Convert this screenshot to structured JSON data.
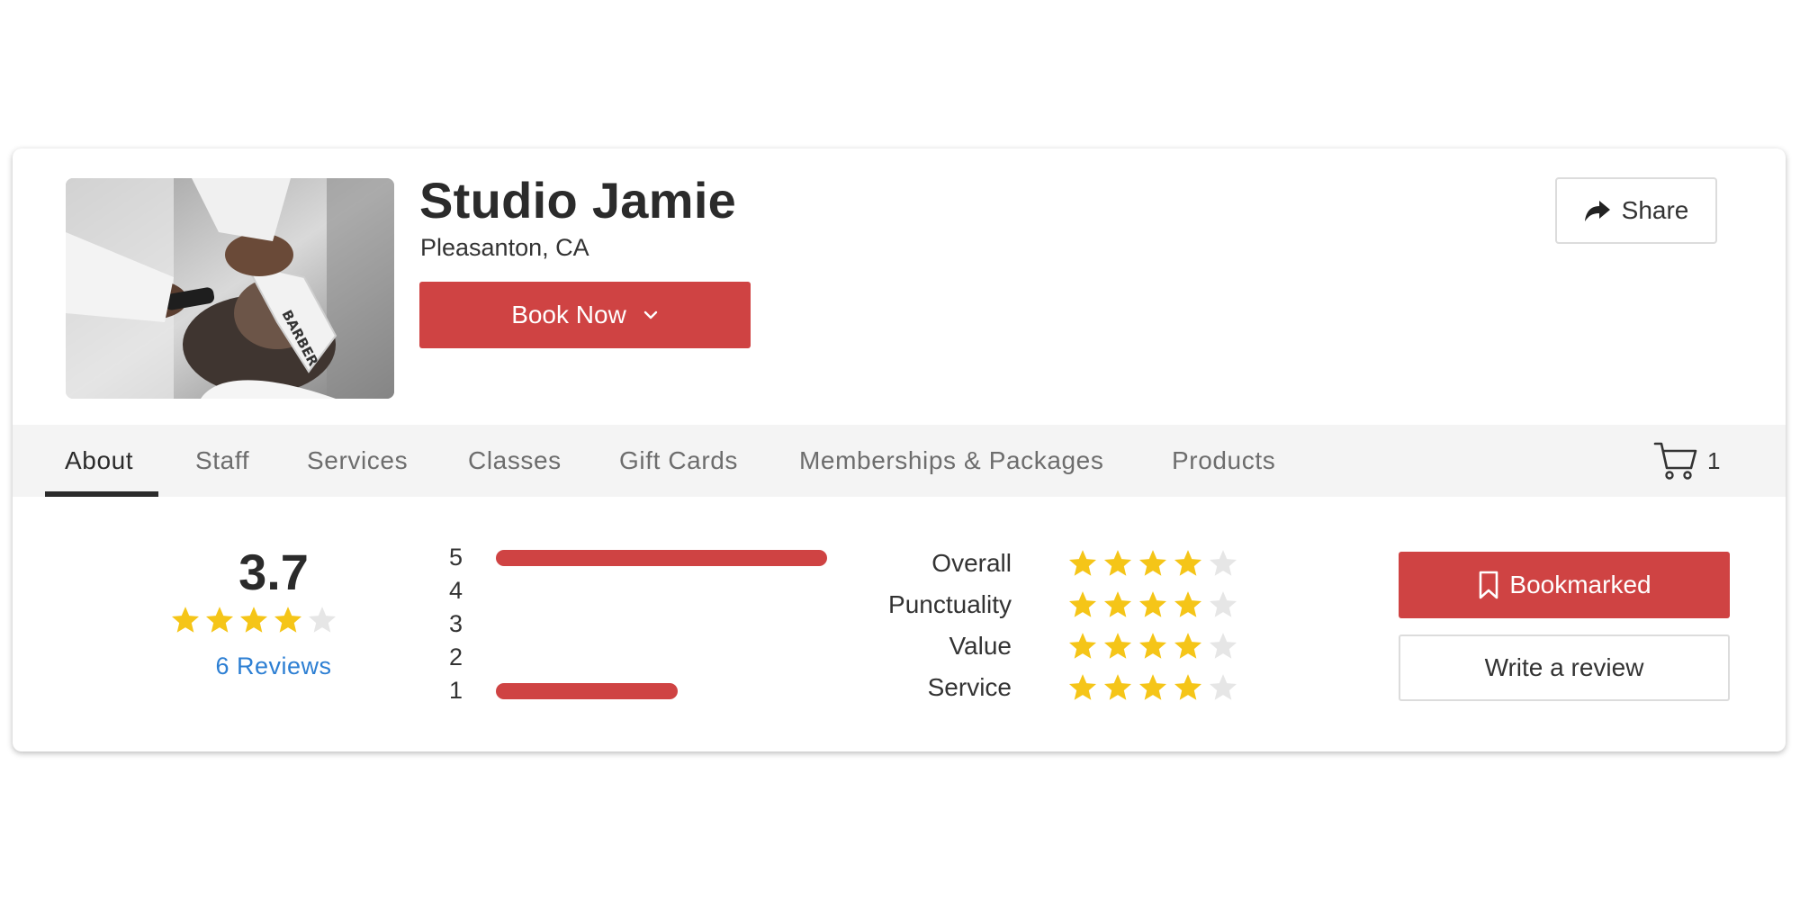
{
  "business": {
    "name": "Studio Jamie",
    "location": "Pleasanton, CA",
    "photo_icon": "barber-photo",
    "photo_text": "BARBER"
  },
  "actions": {
    "book_now": "Book Now",
    "share": "Share",
    "bookmarked": "Bookmarked",
    "write_review": "Write a review"
  },
  "tabs": [
    {
      "label": "About",
      "active": true
    },
    {
      "label": "Staff",
      "active": false
    },
    {
      "label": "Services",
      "active": false
    },
    {
      "label": "Classes",
      "active": false
    },
    {
      "label": "Gift Cards",
      "active": false
    },
    {
      "label": "Memberships & Packages",
      "active": false
    },
    {
      "label": "Products",
      "active": false
    }
  ],
  "cart": {
    "icon": "cart-icon",
    "count": "1"
  },
  "rating": {
    "average": "3.7",
    "average_stars": 4,
    "max_stars": 5,
    "reviews_link": "6 Reviews",
    "distribution": [
      {
        "stars": "5",
        "fraction": 1.0
      },
      {
        "stars": "4",
        "fraction": 0
      },
      {
        "stars": "3",
        "fraction": 0
      },
      {
        "stars": "2",
        "fraction": 0
      },
      {
        "stars": "1",
        "fraction": 0.55
      }
    ],
    "categories": [
      {
        "label": "Overall",
        "stars": 4
      },
      {
        "label": "Punctuality",
        "stars": 4
      },
      {
        "label": "Value",
        "stars": 4
      },
      {
        "label": "Service",
        "stars": 4
      }
    ]
  },
  "colors": {
    "accent": "#cf4343",
    "star_filled": "#f5c518",
    "star_empty": "#e6e6e6",
    "link": "#2d7fd3",
    "tab_bar": "#f4f4f4"
  }
}
